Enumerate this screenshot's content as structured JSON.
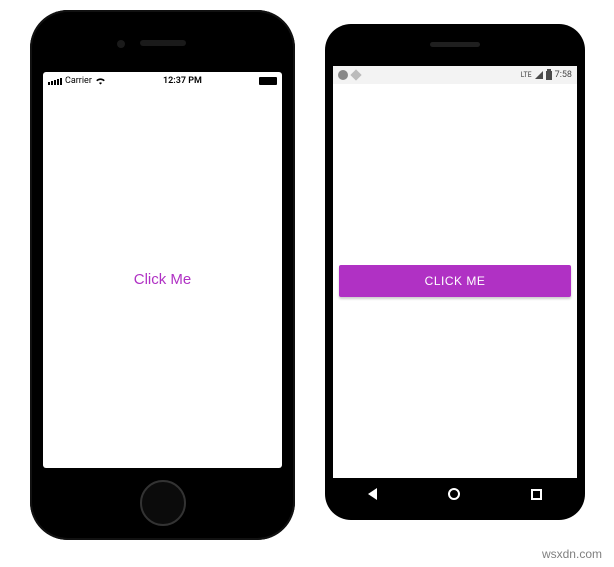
{
  "ios": {
    "status": {
      "carrier": "Carrier",
      "wifi_icon": "wifi",
      "time": "12:37 PM",
      "battery_icon": "battery"
    },
    "button_label": "Click Me"
  },
  "android": {
    "status": {
      "left_icons": [
        "circle",
        "diamond"
      ],
      "network_label": "LTE",
      "signal_icon": "triangle",
      "battery_icon": "battery",
      "time": "7:58"
    },
    "button_label": "CLICK ME",
    "nav": {
      "back": "back",
      "home": "home",
      "recent": "recent"
    },
    "accent_color": "#b031c4"
  },
  "watermark": "wsxdn.com"
}
